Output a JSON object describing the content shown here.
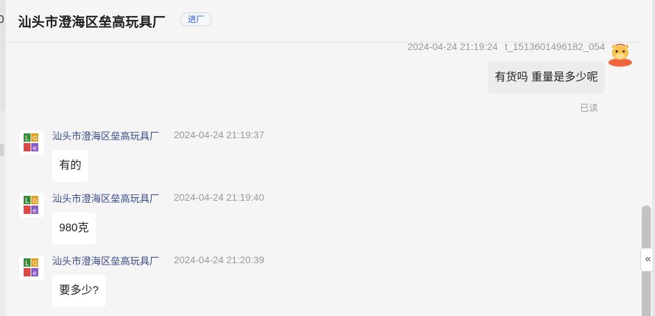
{
  "background": {
    "edge_char": "0"
  },
  "header": {
    "title": "汕头市澄海区垒高玩具厂",
    "badge": "进厂"
  },
  "self_message": {
    "timestamp": "2024-04-24 21:19:24",
    "username": "t_1513601496182_054",
    "text": "有货吗 重量是多少呢",
    "status": "已读",
    "avatar_icon": "cartoon-cow-avatar-icon"
  },
  "messages": [
    {
      "sender": "汕头市澄海区垒高玩具厂",
      "time": "2024-04-24 21:19:37",
      "text": "有的"
    },
    {
      "sender": "汕头市澄海区垒高玩具厂",
      "time": "2024-04-24 21:19:40",
      "text": "980克"
    },
    {
      "sender": "汕头市澄海区垒高玩具厂",
      "time": "2024-04-24 21:20:39",
      "text": "要多少?"
    }
  ],
  "collapse_icon": "double-chevron-left-icon",
  "colors": {
    "badge_text": "#2a5bd7",
    "sender_name": "#3a4a8c",
    "bubble_self": "#ececec",
    "bubble_other": "#ffffff",
    "avatar_self": "#f0673d"
  }
}
